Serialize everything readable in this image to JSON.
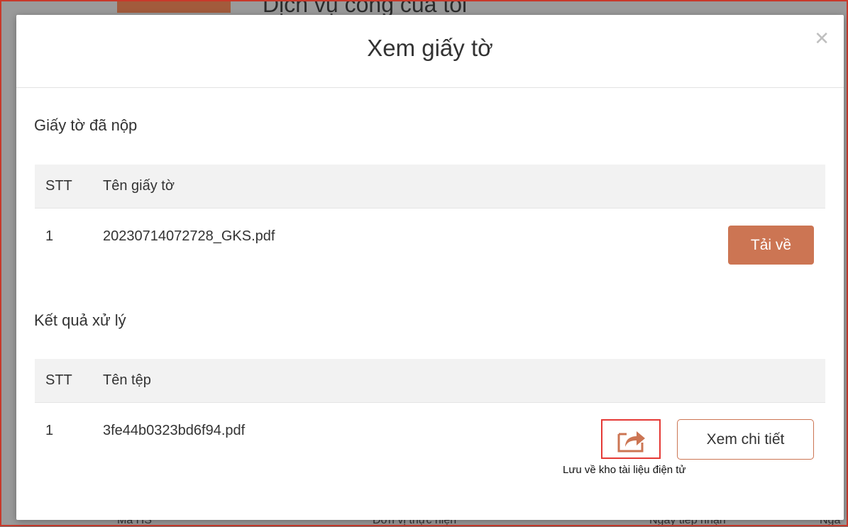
{
  "background": {
    "page_title": "Dịch vụ công của tôi",
    "footer_columns": [
      "Mã HS",
      "Đơn vị thực hiện",
      "Ngày tiếp nhận",
      "Ngà"
    ]
  },
  "modal": {
    "title": "Xem giấy tờ",
    "close_icon": "close-icon",
    "submitted": {
      "heading": "Giấy tờ đã nộp",
      "columns": {
        "stt": "STT",
        "name": "Tên giấy tờ"
      },
      "rows": [
        {
          "stt": "1",
          "name": "20230714072728_GKS.pdf",
          "action": "Tải về"
        }
      ]
    },
    "results": {
      "heading": "Kết quả xử lý",
      "columns": {
        "stt": "STT",
        "name": "Tên tệp"
      },
      "rows": [
        {
          "stt": "1",
          "name": "3fe44b0323bd6f94.pdf",
          "save_icon": "share-icon",
          "save_tooltip": "Lưu về kho tài liệu điện tử",
          "action": "Xem chi tiết"
        }
      ]
    }
  },
  "colors": {
    "accent": "#cc7553",
    "highlight": "#e53935"
  }
}
